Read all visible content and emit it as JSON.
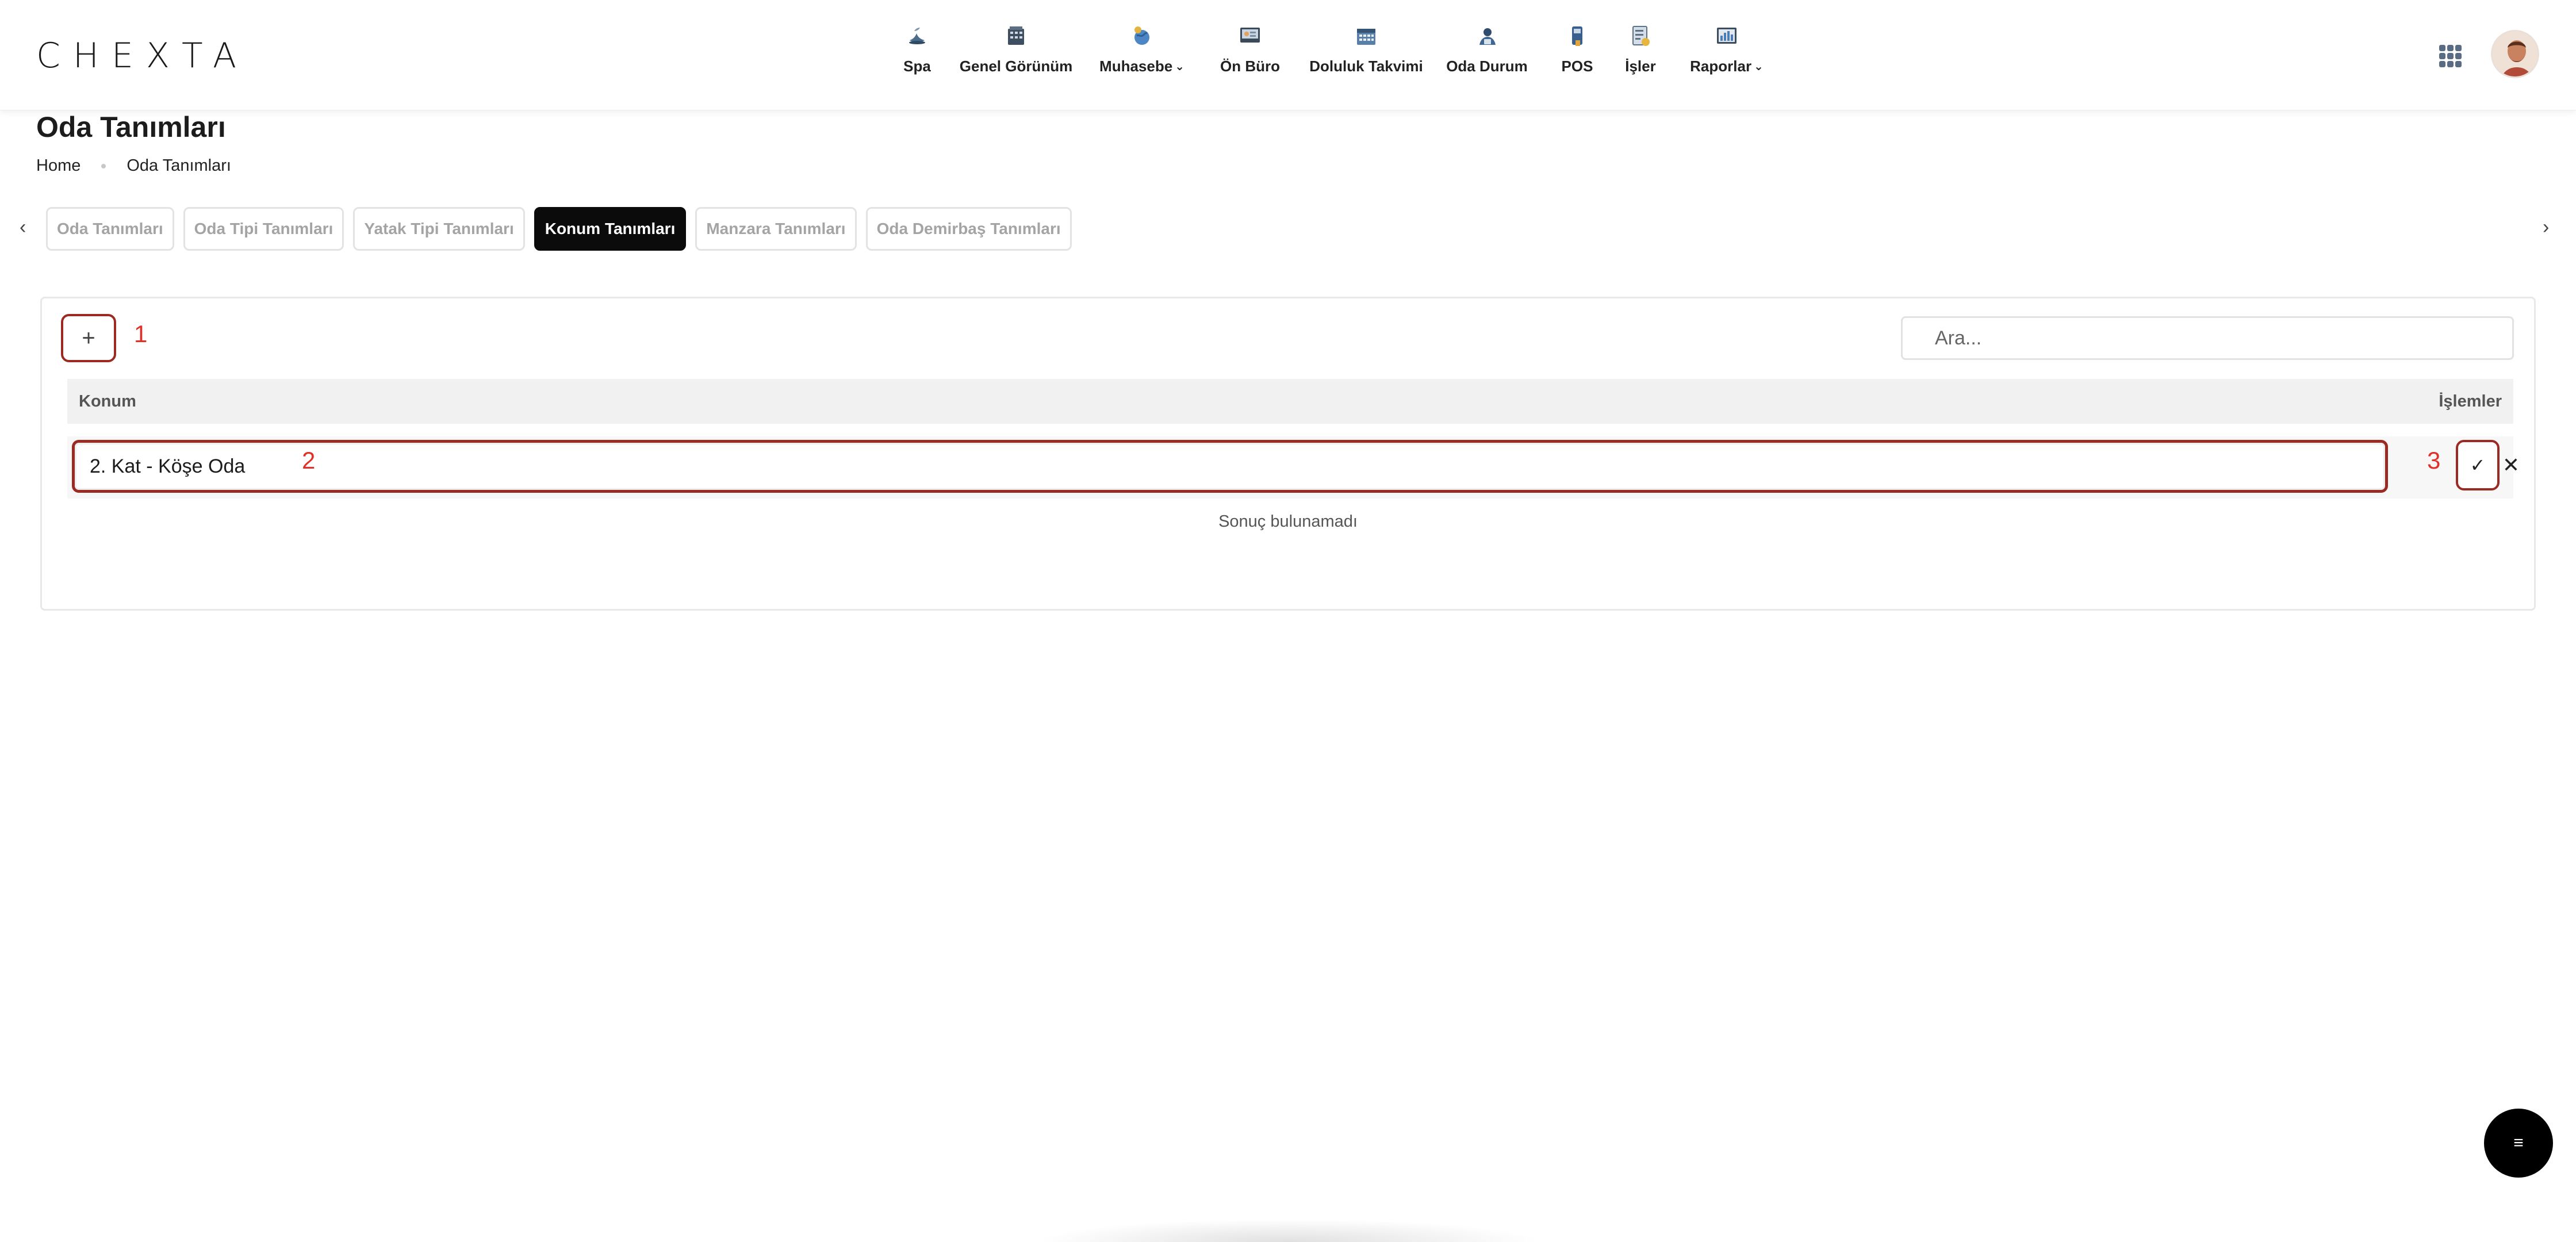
{
  "header": {
    "logo": "CHEXTA",
    "nav": [
      {
        "label": "Spa",
        "icon": "spa-icon",
        "dropdown": false
      },
      {
        "label": "Genel Görünüm",
        "icon": "building-icon",
        "dropdown": false
      },
      {
        "label": "Muhasebe",
        "icon": "globe-coin-icon",
        "dropdown": true
      },
      {
        "label": "Ön Büro",
        "icon": "frontdesk-icon",
        "dropdown": false
      },
      {
        "label": "Doluluk Takvimi",
        "icon": "calendar-icon",
        "dropdown": false
      },
      {
        "label": "Oda Durum",
        "icon": "room-status-icon",
        "dropdown": false
      },
      {
        "label": "POS",
        "icon": "pos-icon",
        "dropdown": false
      },
      {
        "label": "İşler",
        "icon": "tasks-icon",
        "dropdown": false
      },
      {
        "label": "Raporlar",
        "icon": "reports-icon",
        "dropdown": true
      }
    ]
  },
  "page": {
    "title": "Oda Tanımları",
    "breadcrumb": [
      "Home",
      "Oda Tanımları"
    ]
  },
  "tabs": [
    {
      "label": "Oda Tanımları",
      "active": false
    },
    {
      "label": "Oda Tipi Tanımları",
      "active": false
    },
    {
      "label": "Yatak Tipi Tanımları",
      "active": false
    },
    {
      "label": "Konum Tanımları",
      "active": true
    },
    {
      "label": "Manzara Tanımları",
      "active": false
    },
    {
      "label": "Oda Demirbaş Tanımları",
      "active": false
    }
  ],
  "table": {
    "search_placeholder": "Ara...",
    "add_label": "+",
    "columns": [
      "Konum",
      "İşlemler"
    ],
    "edit_value": "2. Kat - Köşe Oda",
    "confirm_label": "✓",
    "cancel_label": "✕",
    "empty_text": "Sonuç bulunamadı"
  },
  "annotations": [
    "1",
    "2",
    "3"
  ],
  "fab_label": "≡",
  "colors": {
    "accent": "#9b2a22",
    "annotation": "#e03128",
    "active_tab": "#0b0b0b"
  }
}
